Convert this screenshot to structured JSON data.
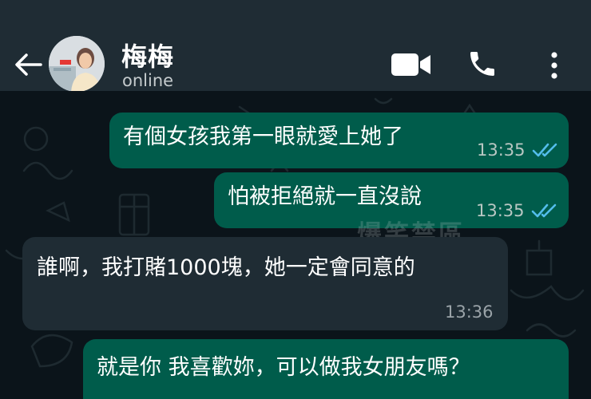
{
  "header": {
    "contact_name": "梅梅",
    "status": "online"
  },
  "messages": [
    {
      "direction": "outgoing",
      "text": "有個女孩我第一眼就愛上她了",
      "time": "13:35",
      "read": true
    },
    {
      "direction": "outgoing",
      "text": "怕被拒絕就一直沒說",
      "time": "13:35",
      "read": true
    },
    {
      "direction": "incoming",
      "text": "誰啊，我打賭1000塊，她一定會同意的",
      "time": "13:36"
    },
    {
      "direction": "outgoing",
      "text": "就是你 我喜歡妳，可以做我女朋友嗎？"
    }
  ],
  "watermark": "爆笑禁區",
  "colors": {
    "header_bg": "#1f2c34",
    "chat_bg": "#0b141a",
    "outgoing_bubble": "#005c4b",
    "incoming_bubble": "#1f2c34",
    "read_ticks": "#53bdeb"
  },
  "icons": [
    "back-arrow-icon",
    "video-call-icon",
    "phone-icon",
    "more-options-icon",
    "double-check-icon"
  ]
}
